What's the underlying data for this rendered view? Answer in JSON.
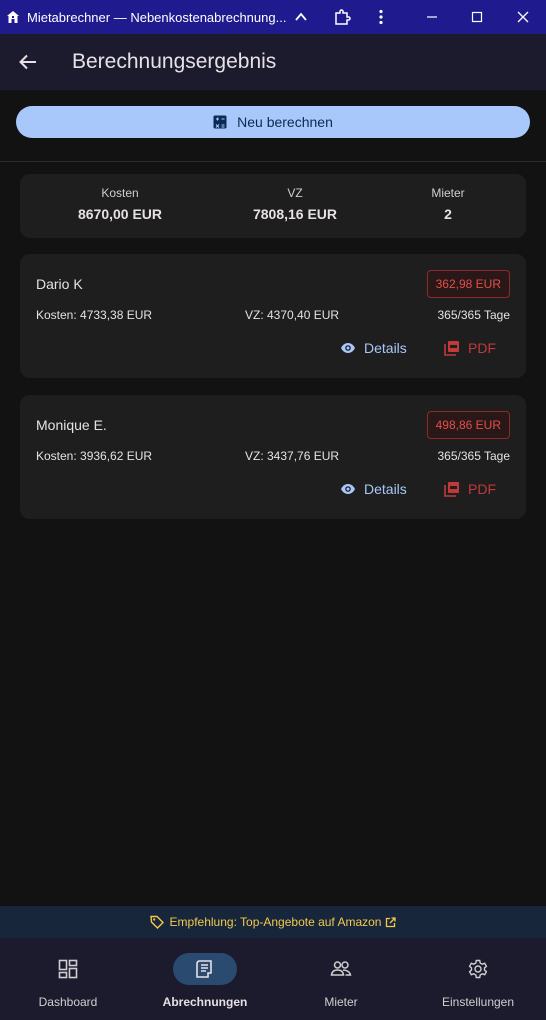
{
  "window": {
    "title": "Mietabrechner — Nebenkostenabrechnung...",
    "icons": [
      "home-icon",
      "chevron-up-icon",
      "extension-icon",
      "more-vert-icon",
      "minimize-icon",
      "maximize-icon",
      "close-icon"
    ]
  },
  "appbar": {
    "title": "Berechnungsergebnis",
    "back_icon": "arrow-back-icon"
  },
  "recalc": {
    "label": "Neu berechnen",
    "icon": "calculator-icon"
  },
  "summary": {
    "costs_label": "Kosten",
    "costs_value": "8670,00 EUR",
    "prepay_label": "VZ",
    "prepay_value": "7808,16 EUR",
    "tenants_label": "Mieter",
    "tenants_value": "2"
  },
  "tenants": [
    {
      "name": "Dario K",
      "balance": "362,98 EUR",
      "costs": "Kosten: 4733,38 EUR",
      "prepay": "VZ: 4370,40 EUR",
      "days": "365/365 Tage",
      "details_label": "Details",
      "pdf_label": "PDF"
    },
    {
      "name": "Monique E.",
      "balance": "498,86 EUR",
      "costs": "Kosten: 3936,62 EUR",
      "prepay": "VZ: 3437,76 EUR",
      "days": "365/365 Tage",
      "details_label": "Details",
      "pdf_label": "PDF"
    }
  ],
  "promo": {
    "text": "Empfehlung: Top-Angebote auf Amazon"
  },
  "nav": {
    "items": [
      {
        "label": "Dashboard",
        "icon": "dashboard-icon"
      },
      {
        "label": "Abrechnungen",
        "icon": "receipt-icon",
        "active": true
      },
      {
        "label": "Mieter",
        "icon": "people-icon"
      },
      {
        "label": "Einstellungen",
        "icon": "settings-icon"
      }
    ]
  },
  "colors": {
    "titlebar": "#1f1b8f",
    "accent": "#a8c7fa",
    "negative": "#e0504a",
    "promo_text": "#f2c94c"
  }
}
